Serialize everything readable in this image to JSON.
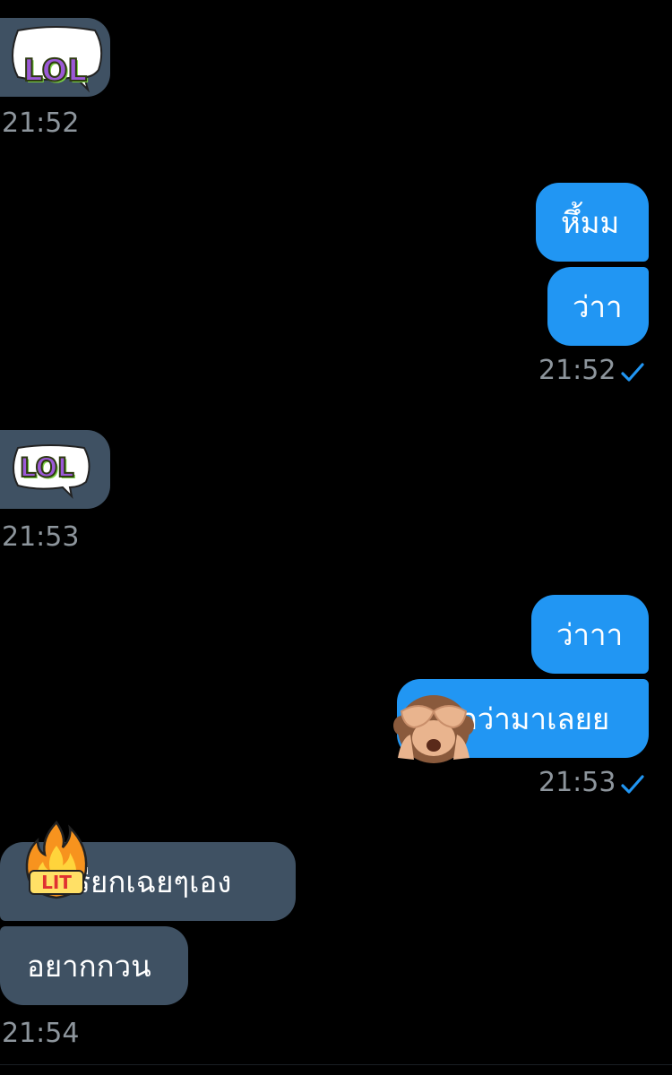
{
  "colors": {
    "background": "#000000",
    "incoming_bubble": "#3f5163",
    "outgoing_bubble": "#2196f3",
    "timestamp": "#8d959c",
    "read_check": "#2196f3"
  },
  "messages": [
    {
      "direction": "incoming",
      "type": "sticker",
      "sticker_text": "LOL",
      "icon": "lol-sticker-icon"
    },
    {
      "direction": "incoming",
      "type": "timestamp",
      "time": "21:52"
    },
    {
      "direction": "outgoing",
      "type": "text",
      "text": "หึ้มม"
    },
    {
      "direction": "outgoing",
      "type": "text",
      "text": "ว่าา"
    },
    {
      "direction": "outgoing",
      "type": "timestamp",
      "time": "21:52",
      "status": "read",
      "icon": "check-icon"
    },
    {
      "direction": "incoming",
      "type": "sticker",
      "sticker_text": "LOL",
      "icon": "lol-sticker-icon"
    },
    {
      "direction": "incoming",
      "type": "timestamp",
      "time": "21:53"
    },
    {
      "direction": "outgoing",
      "type": "text",
      "text": "ว่าาา"
    },
    {
      "direction": "outgoing",
      "type": "text",
      "text": "ทักว่ามาเลยย",
      "overlay_icon": "see-no-evil-monkey-icon"
    },
    {
      "direction": "outgoing",
      "type": "timestamp",
      "time": "21:53",
      "status": "read",
      "icon": "check-icon"
    },
    {
      "direction": "incoming",
      "type": "text",
      "text": "เรียกเฉยๆเอง",
      "overlay_icon": "lit-fire-sticker-icon",
      "overlay_text": "LIT"
    },
    {
      "direction": "incoming",
      "type": "text",
      "text": "อยากกวน"
    },
    {
      "direction": "incoming",
      "type": "timestamp",
      "time": "21:54"
    }
  ]
}
